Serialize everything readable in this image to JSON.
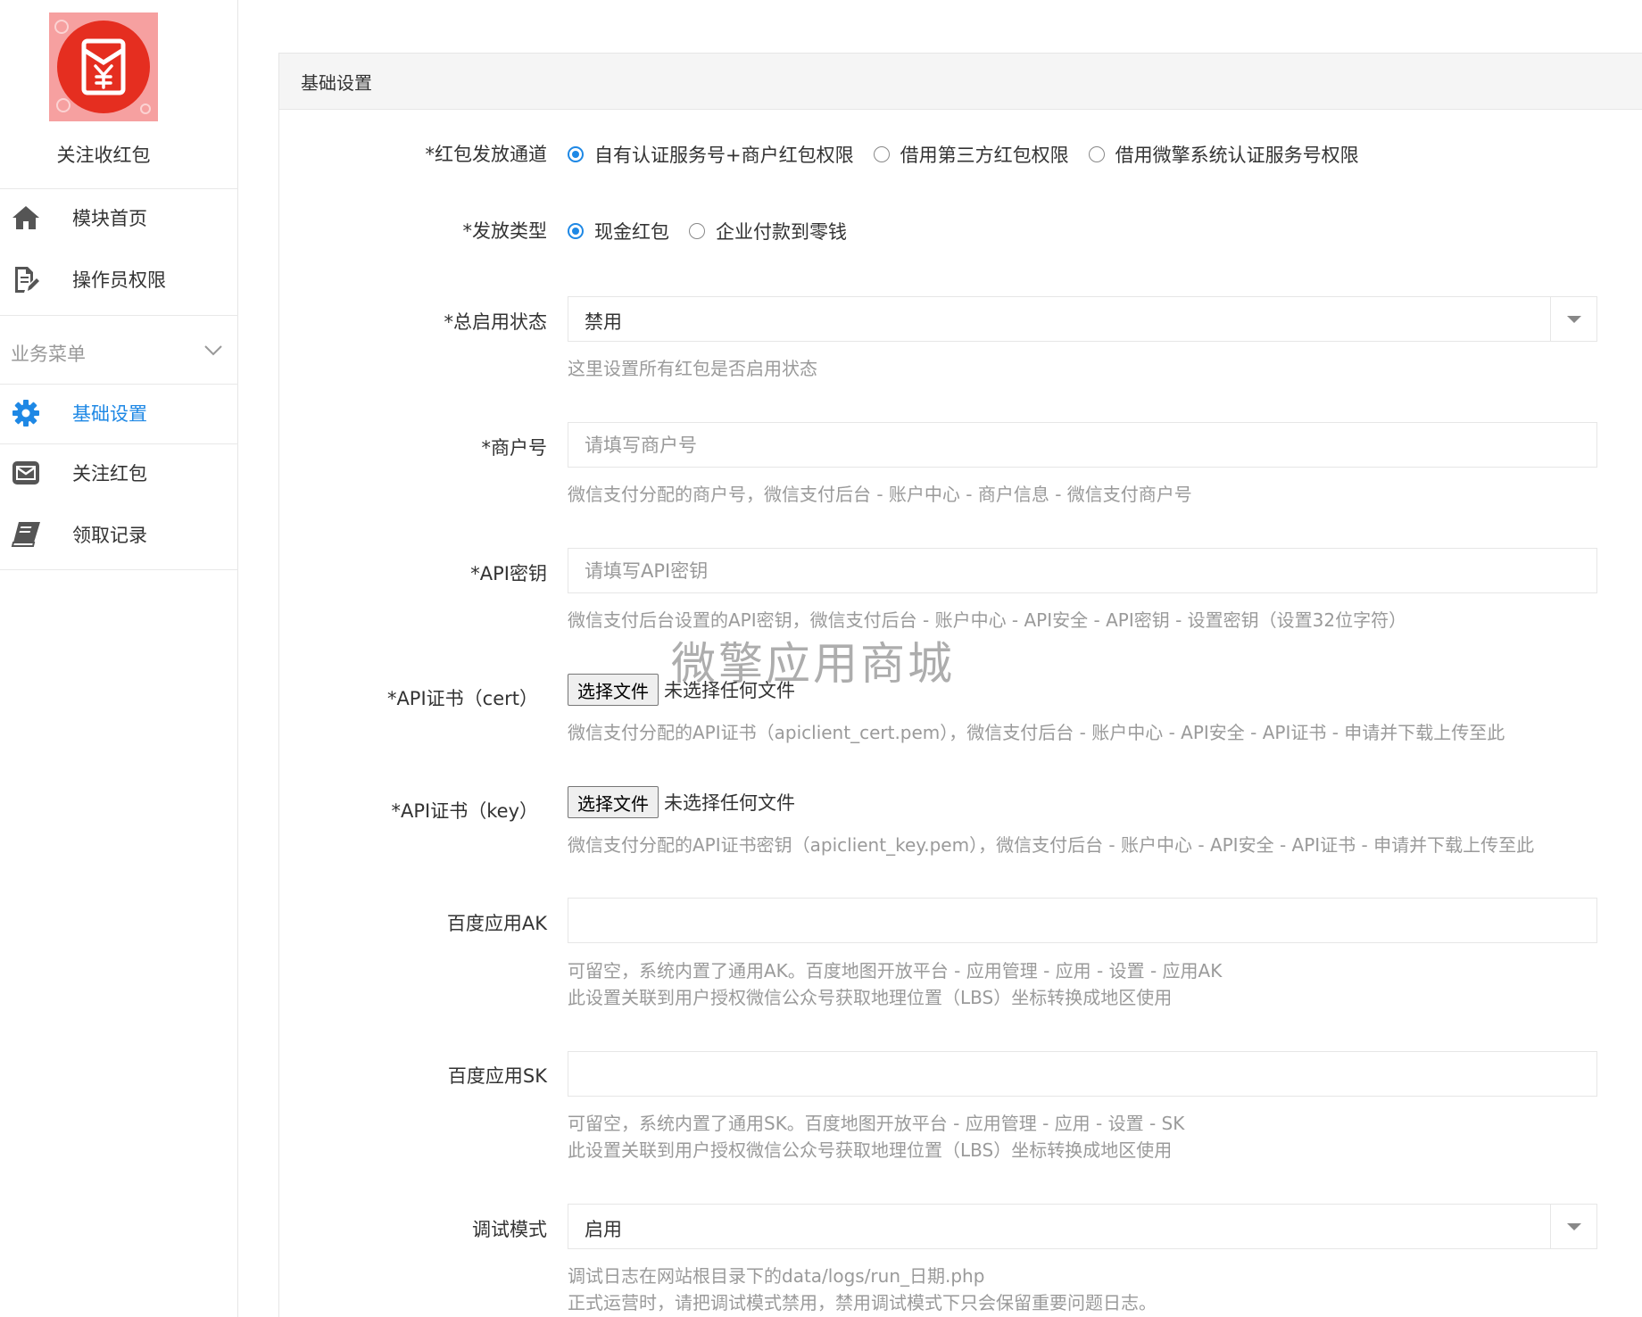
{
  "sidebar": {
    "app_name": "关注收红包",
    "top_items": [
      {
        "label": "模块首页",
        "icon": "home-icon"
      },
      {
        "label": "操作员权限",
        "icon": "document-edit-icon"
      }
    ],
    "section": {
      "label": "业务菜单",
      "icon": "chevron-down-icon"
    },
    "menu_items": [
      {
        "label": "基础设置",
        "icon": "gear-icon",
        "active": true
      },
      {
        "label": "关注红包",
        "icon": "envelope-icon",
        "active": false
      },
      {
        "label": "领取记录",
        "icon": "book-icon",
        "active": false
      }
    ],
    "accent_color": "#1e88e5"
  },
  "panel": {
    "title": "基础设置",
    "fields": {
      "channel": {
        "label": "*红包发放通道",
        "options": [
          "自有认证服务号+商户红包权限",
          "借用第三方红包权限",
          "借用微擎系统认证服务号权限"
        ],
        "selected": 0
      },
      "send_type": {
        "label": "*发放类型",
        "options": [
          "现金红包",
          "企业付款到零钱"
        ],
        "selected": 0
      },
      "status": {
        "label": "*总启用状态",
        "value": "禁用",
        "help": "这里设置所有红包是否启用状态"
      },
      "merchant_id": {
        "label": "*商户号",
        "placeholder": "请填写商户号",
        "help": "微信支付分配的商户号，微信支付后台 - 账户中心 - 商户信息 - 微信支付商户号"
      },
      "api_key": {
        "label": "*API密钥",
        "placeholder": "请填写API密钥",
        "help": "微信支付后台设置的API密钥，微信支付后台 - 账户中心 - API安全 - API密钥 - 设置密钥（设置32位字符）"
      },
      "cert": {
        "label": "*API证书（cert）",
        "button": "选择文件",
        "status": "未选择任何文件",
        "help": "微信支付分配的API证书（apiclient_cert.pem），微信支付后台 - 账户中心 - API安全 - API证书 - 申请并下载上传至此"
      },
      "key": {
        "label": "*API证书（key）",
        "button": "选择文件",
        "status": "未选择任何文件",
        "help": "微信支付分配的API证书密钥（apiclient_key.pem），微信支付后台 - 账户中心 - API安全 - API证书 - 申请并下载上传至此"
      },
      "baidu_ak": {
        "label": "百度应用AK",
        "value": "",
        "help_1": "可留空，系统内置了通用AK。百度地图开放平台 - 应用管理 - 应用 - 设置 - 应用AK",
        "help_2": "此设置关联到用户授权微信公众号获取地理位置（LBS）坐标转换成地区使用"
      },
      "baidu_sk": {
        "label": "百度应用SK",
        "value": "",
        "help_1": "可留空，系统内置了通用SK。百度地图开放平台 - 应用管理 - 应用 - 设置 - SK",
        "help_2": "此设置关联到用户授权微信公众号获取地理位置（LBS）坐标转换成地区使用"
      },
      "debug": {
        "label": "调试模式",
        "value": "启用",
        "help_1": "调试日志在网站根目录下的data/logs/run_日期.php",
        "help_2": "正式运营时，请把调试模式禁用，禁用调试模式下只会保留重要问题日志。"
      }
    }
  },
  "watermark": "微擎应用商城"
}
